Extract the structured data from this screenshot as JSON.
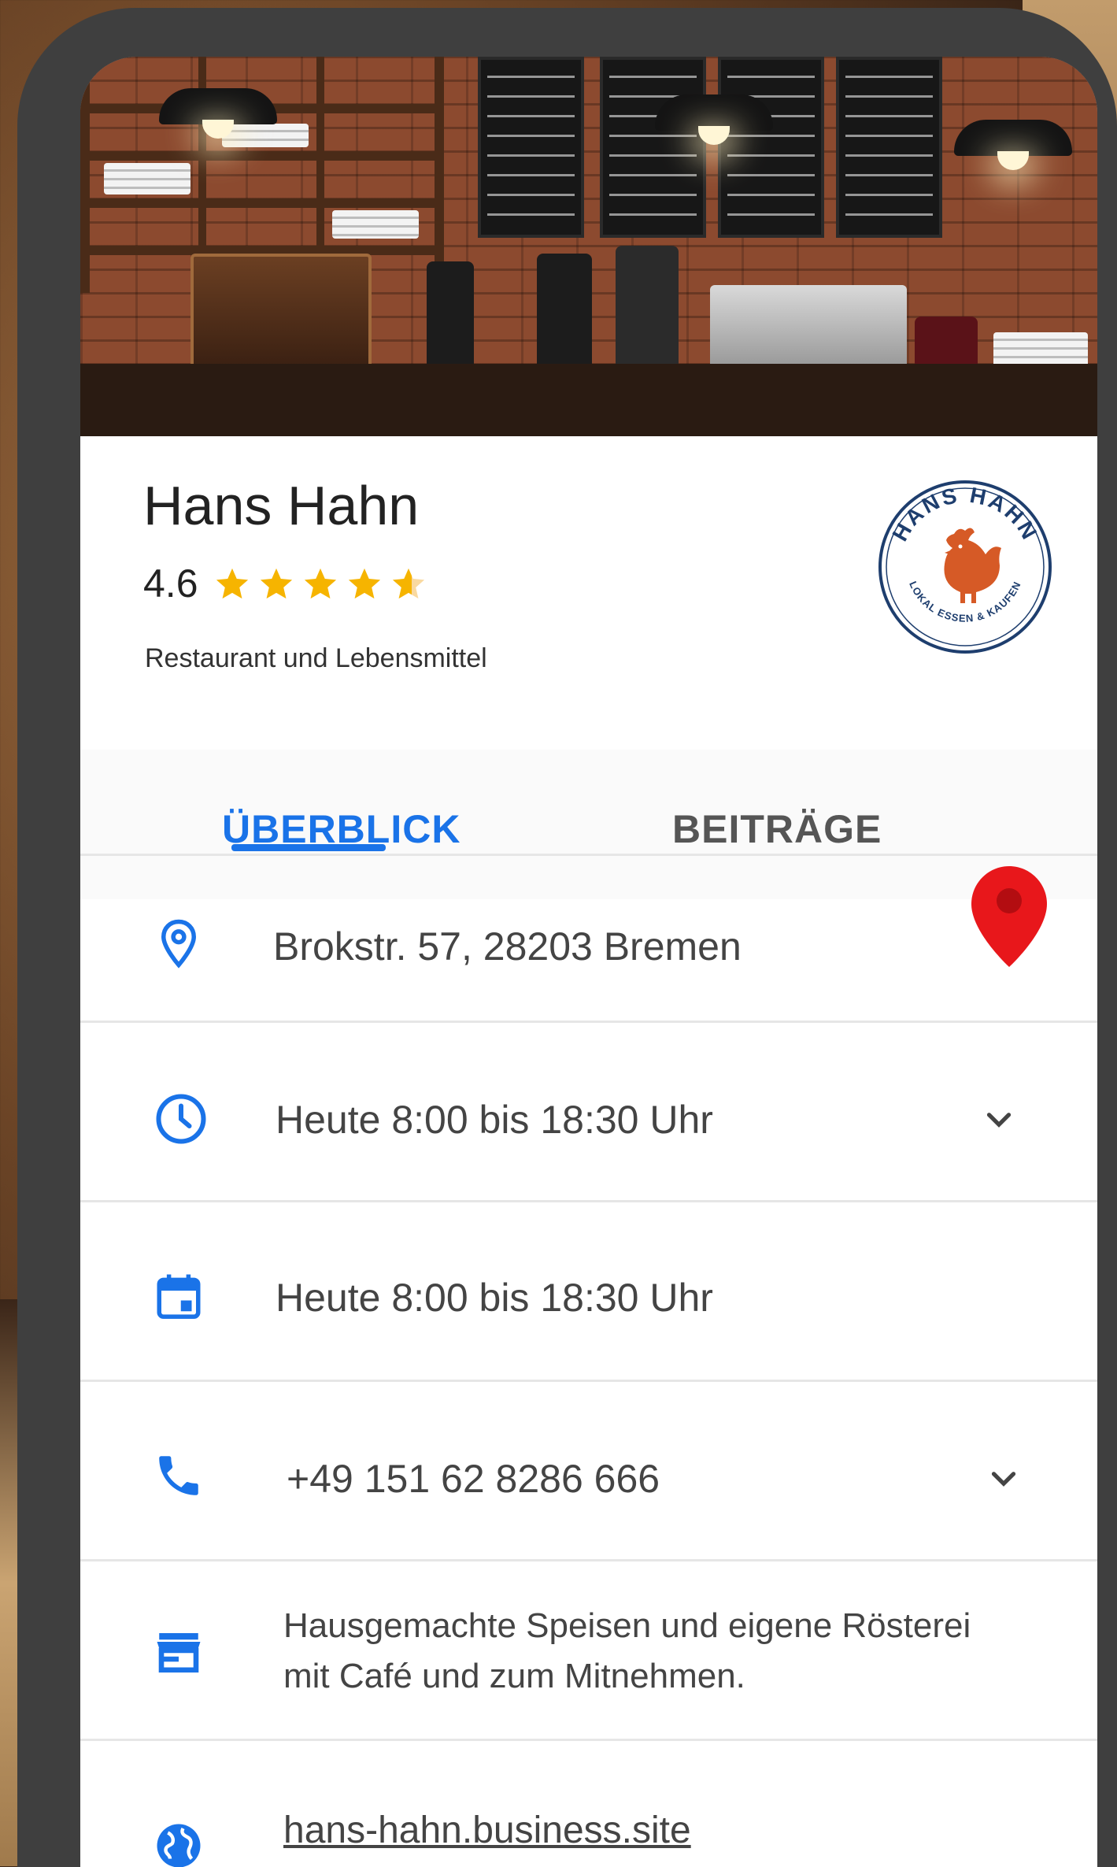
{
  "business": {
    "name": "Hans Hahn",
    "rating": "4.6",
    "category": "Restaurant und Lebensmittel"
  },
  "logo": {
    "top_text": "HANS HAHN",
    "bottom_text": "LOKAL ESSEN & KAUFEN"
  },
  "tabs": {
    "overview": "ÜBERBLICK",
    "posts": "BEITRÄGE"
  },
  "info": {
    "address": "Brokstr. 57, 28203 Bremen",
    "hours": "Heute 8:00 bis 18:30 Uhr",
    "hours_special": "Heute 8:00 bis 18:30 Uhr",
    "phone": "+49 151 62 8286 666",
    "description_line1": "Hausgemachte Speisen und eigene Rösterei",
    "description_line2": "mit Café und zum Mitnehmen.",
    "website": "hans-hahn.business.site"
  },
  "colors": {
    "accent": "#1a73e8",
    "star": "#f6b400",
    "pin": "#e8171b",
    "logo_blue": "#1e3e6e",
    "logo_orange": "#d65a26"
  },
  "icons": {
    "address": "location-pin-icon",
    "hours": "clock-icon",
    "calendar": "calendar-icon",
    "phone": "phone-icon",
    "store": "storefront-icon",
    "website": "globe-icon",
    "map": "map-pin-icon",
    "expand": "chevron-down-icon"
  }
}
